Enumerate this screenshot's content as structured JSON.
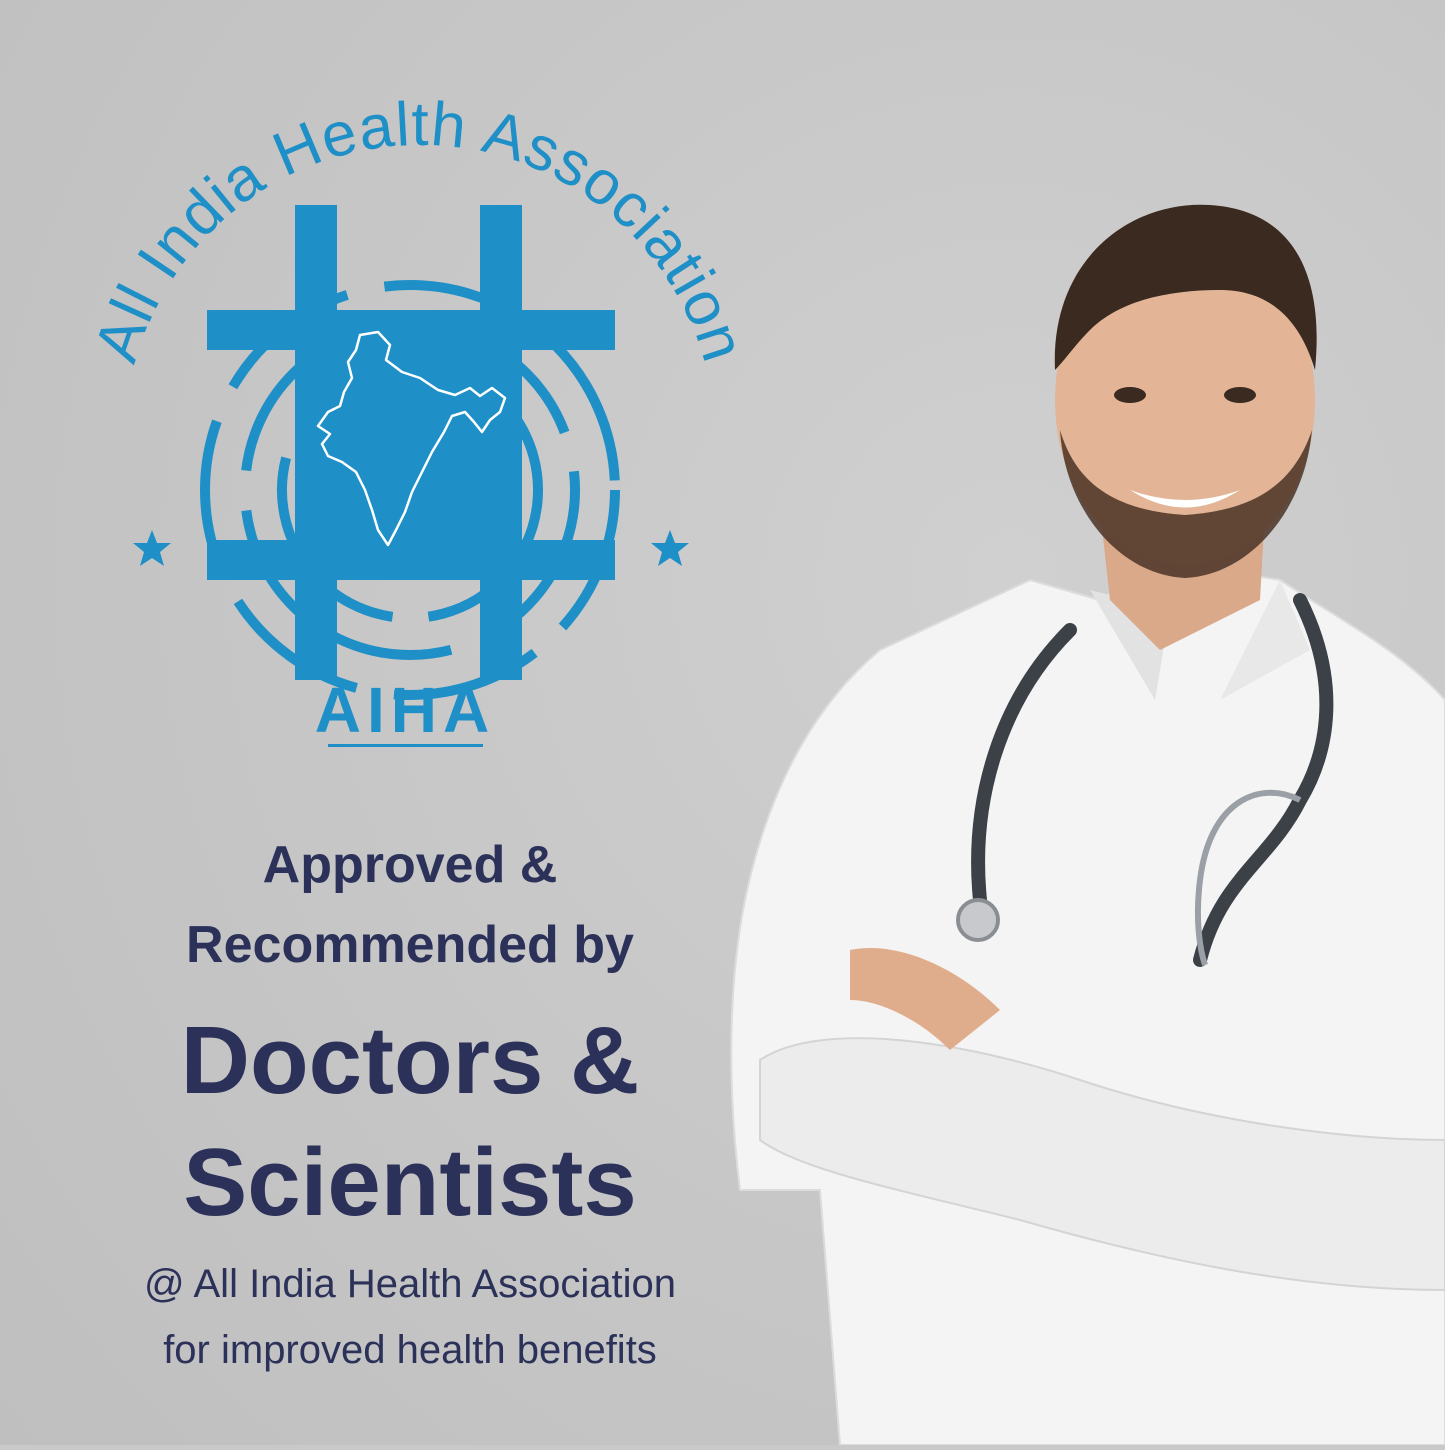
{
  "logo": {
    "arc_text": "All India Health Association",
    "abbreviation": "AIHA",
    "color": "#1e8fc7"
  },
  "headline": {
    "line1": "Approved &",
    "line2": "Recommended by",
    "line3": "Doctors &",
    "line4": "Scientists",
    "line5": "@ All India Health Association",
    "line6": "for improved health benefits",
    "color": "#2b3158"
  },
  "photo": {
    "subject": "doctor with stethoscope and crossed arms"
  }
}
